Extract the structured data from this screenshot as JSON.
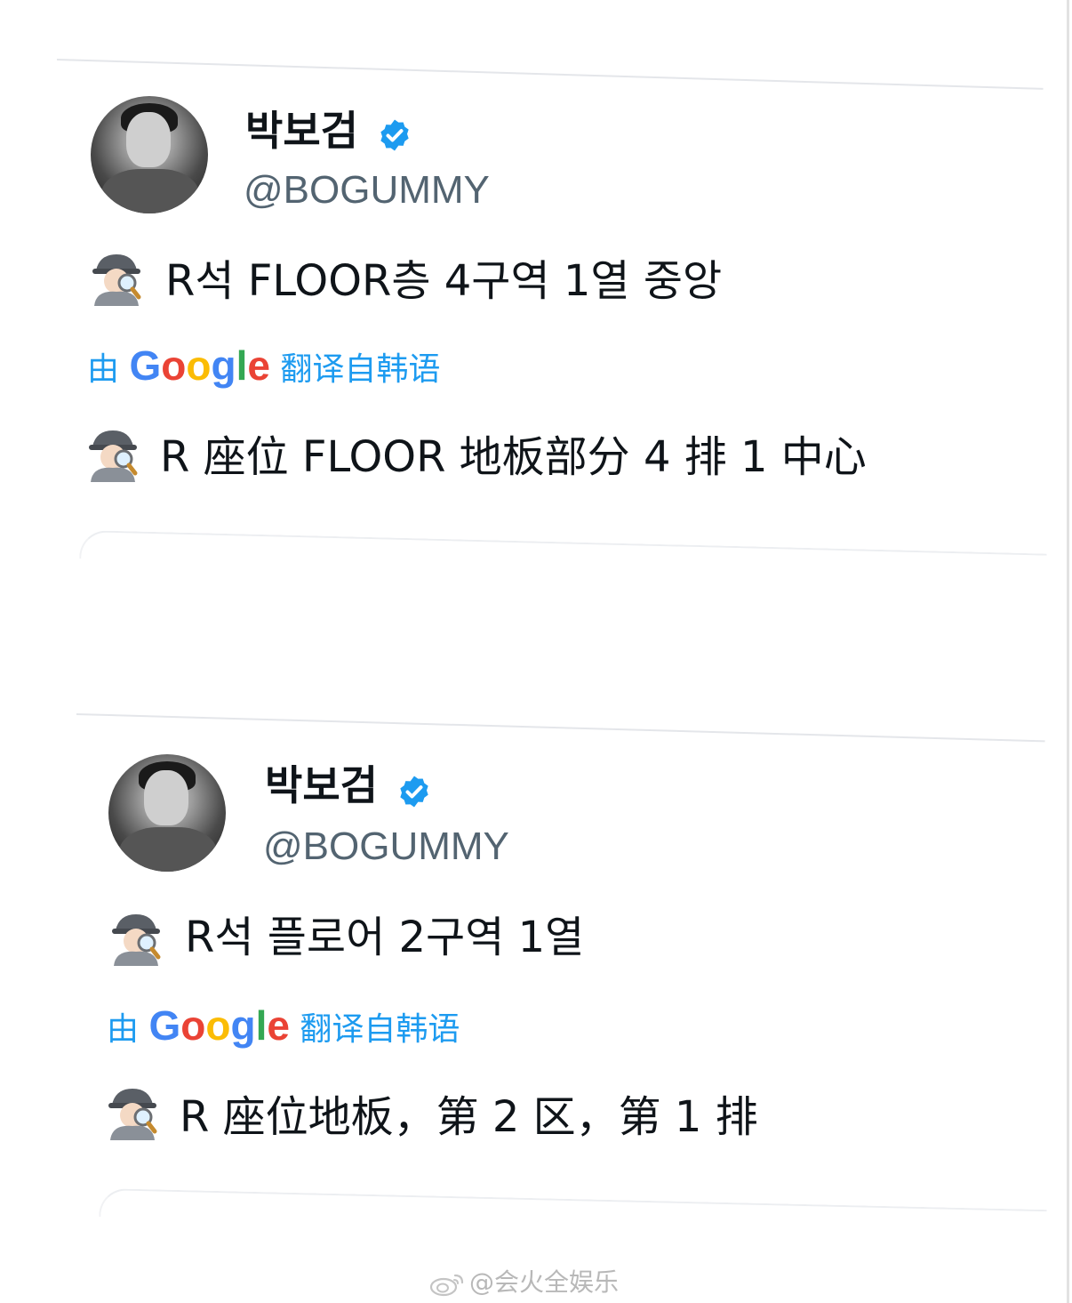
{
  "tweets": [
    {
      "author_name": "박보검",
      "handle": "@BOGUMMY",
      "verified_icon": "verified-badge-icon",
      "emoji": "detective-emoji",
      "text": "R석 FLOOR층 4구역 1열 중앙",
      "translated_prefix": "由",
      "translated_brand": "Google",
      "translated_suffix": "翻译自韩语",
      "translation": "R 座位 FLOOR 地板部分 4 排 1 中心"
    },
    {
      "author_name": "박보검",
      "handle": "@BOGUMMY",
      "verified_icon": "verified-badge-icon",
      "emoji": "detective-emoji",
      "text": "R석 플로어 2구역 1열",
      "translated_prefix": "由",
      "translated_brand": "Google",
      "translated_suffix": "翻译自韩语",
      "translation": "R 座位地板，第 2 区，第 1 排"
    }
  ],
  "watermark": "@会火全娱乐",
  "colors": {
    "verified": "#1d9bf0",
    "link": "#1d9bf0",
    "handle": "#536471",
    "text": "#0f1419"
  }
}
